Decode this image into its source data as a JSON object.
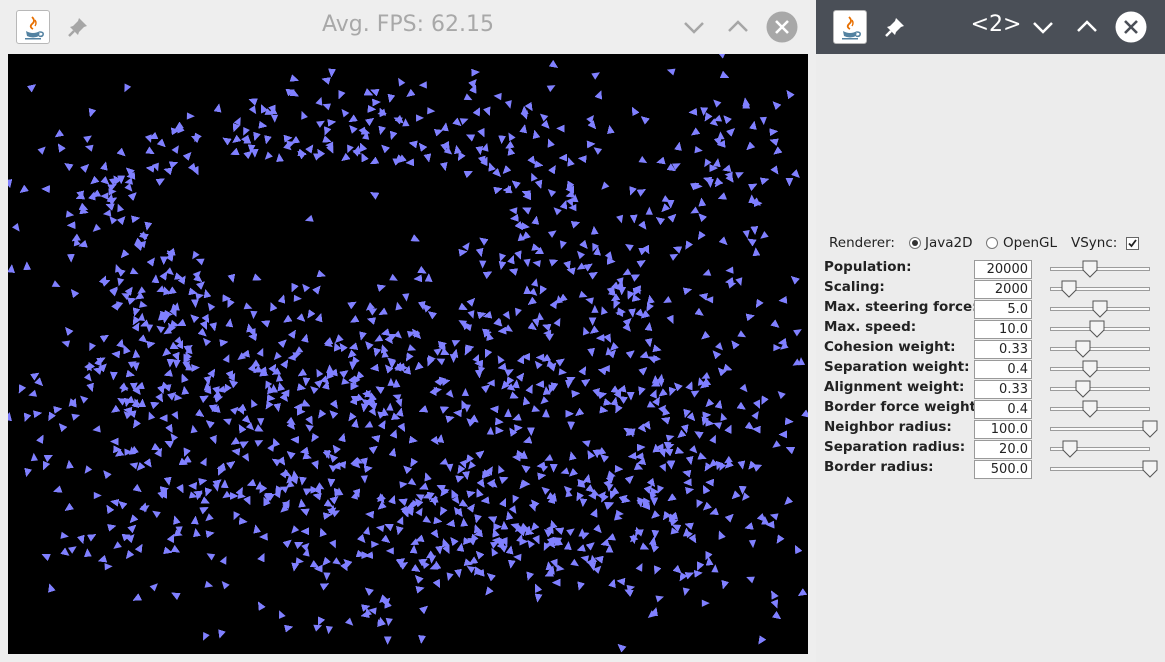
{
  "window_main": {
    "title": "Avg. FPS: 62.15",
    "icons": {
      "app": "java-icon",
      "pin": "pin-icon",
      "minimize": "chevron-down-icon",
      "maximize": "chevron-up-icon",
      "close": "close-icon"
    },
    "canvas_background": "#000000",
    "boid_color": "#8080ff"
  },
  "window_controls": {
    "title": "<2>",
    "titlebar_color": "#4a4f57",
    "icons": {
      "app": "java-icon",
      "pin": "pin-icon",
      "minimize": "chevron-down-icon",
      "maximize": "chevron-up-icon",
      "close": "close-icon"
    }
  },
  "renderer": {
    "label": "Renderer:",
    "options": [
      {
        "label": "Java2D",
        "selected": true
      },
      {
        "label": "OpenGL",
        "selected": false
      }
    ],
    "vsync_label": "VSync:",
    "vsync_checked": true
  },
  "parameters": [
    {
      "label": "Population:",
      "value": "20000",
      "slider": 0.4
    },
    {
      "label": "Scaling:",
      "value": "2000",
      "slider": 0.19
    },
    {
      "label": "Max. steering force:",
      "value": "5.0",
      "slider": 0.5
    },
    {
      "label": "Max. speed:",
      "value": "10.0",
      "slider": 0.47
    },
    {
      "label": "Cohesion weight:",
      "value": "0.33",
      "slider": 0.33
    },
    {
      "label": "Separation weight:",
      "value": "0.4",
      "slider": 0.4
    },
    {
      "label": "Alignment weight:",
      "value": "0.33",
      "slider": 0.33
    },
    {
      "label": "Border force weight:",
      "value": "0.4",
      "slider": 0.4
    },
    {
      "label": "Neighbor radius:",
      "value": "100.0",
      "slider": 1.0
    },
    {
      "label": "Separation radius:",
      "value": "20.0",
      "slider": 0.2
    },
    {
      "label": "Border radius:",
      "value": "500.0",
      "slider": 1.0
    }
  ]
}
